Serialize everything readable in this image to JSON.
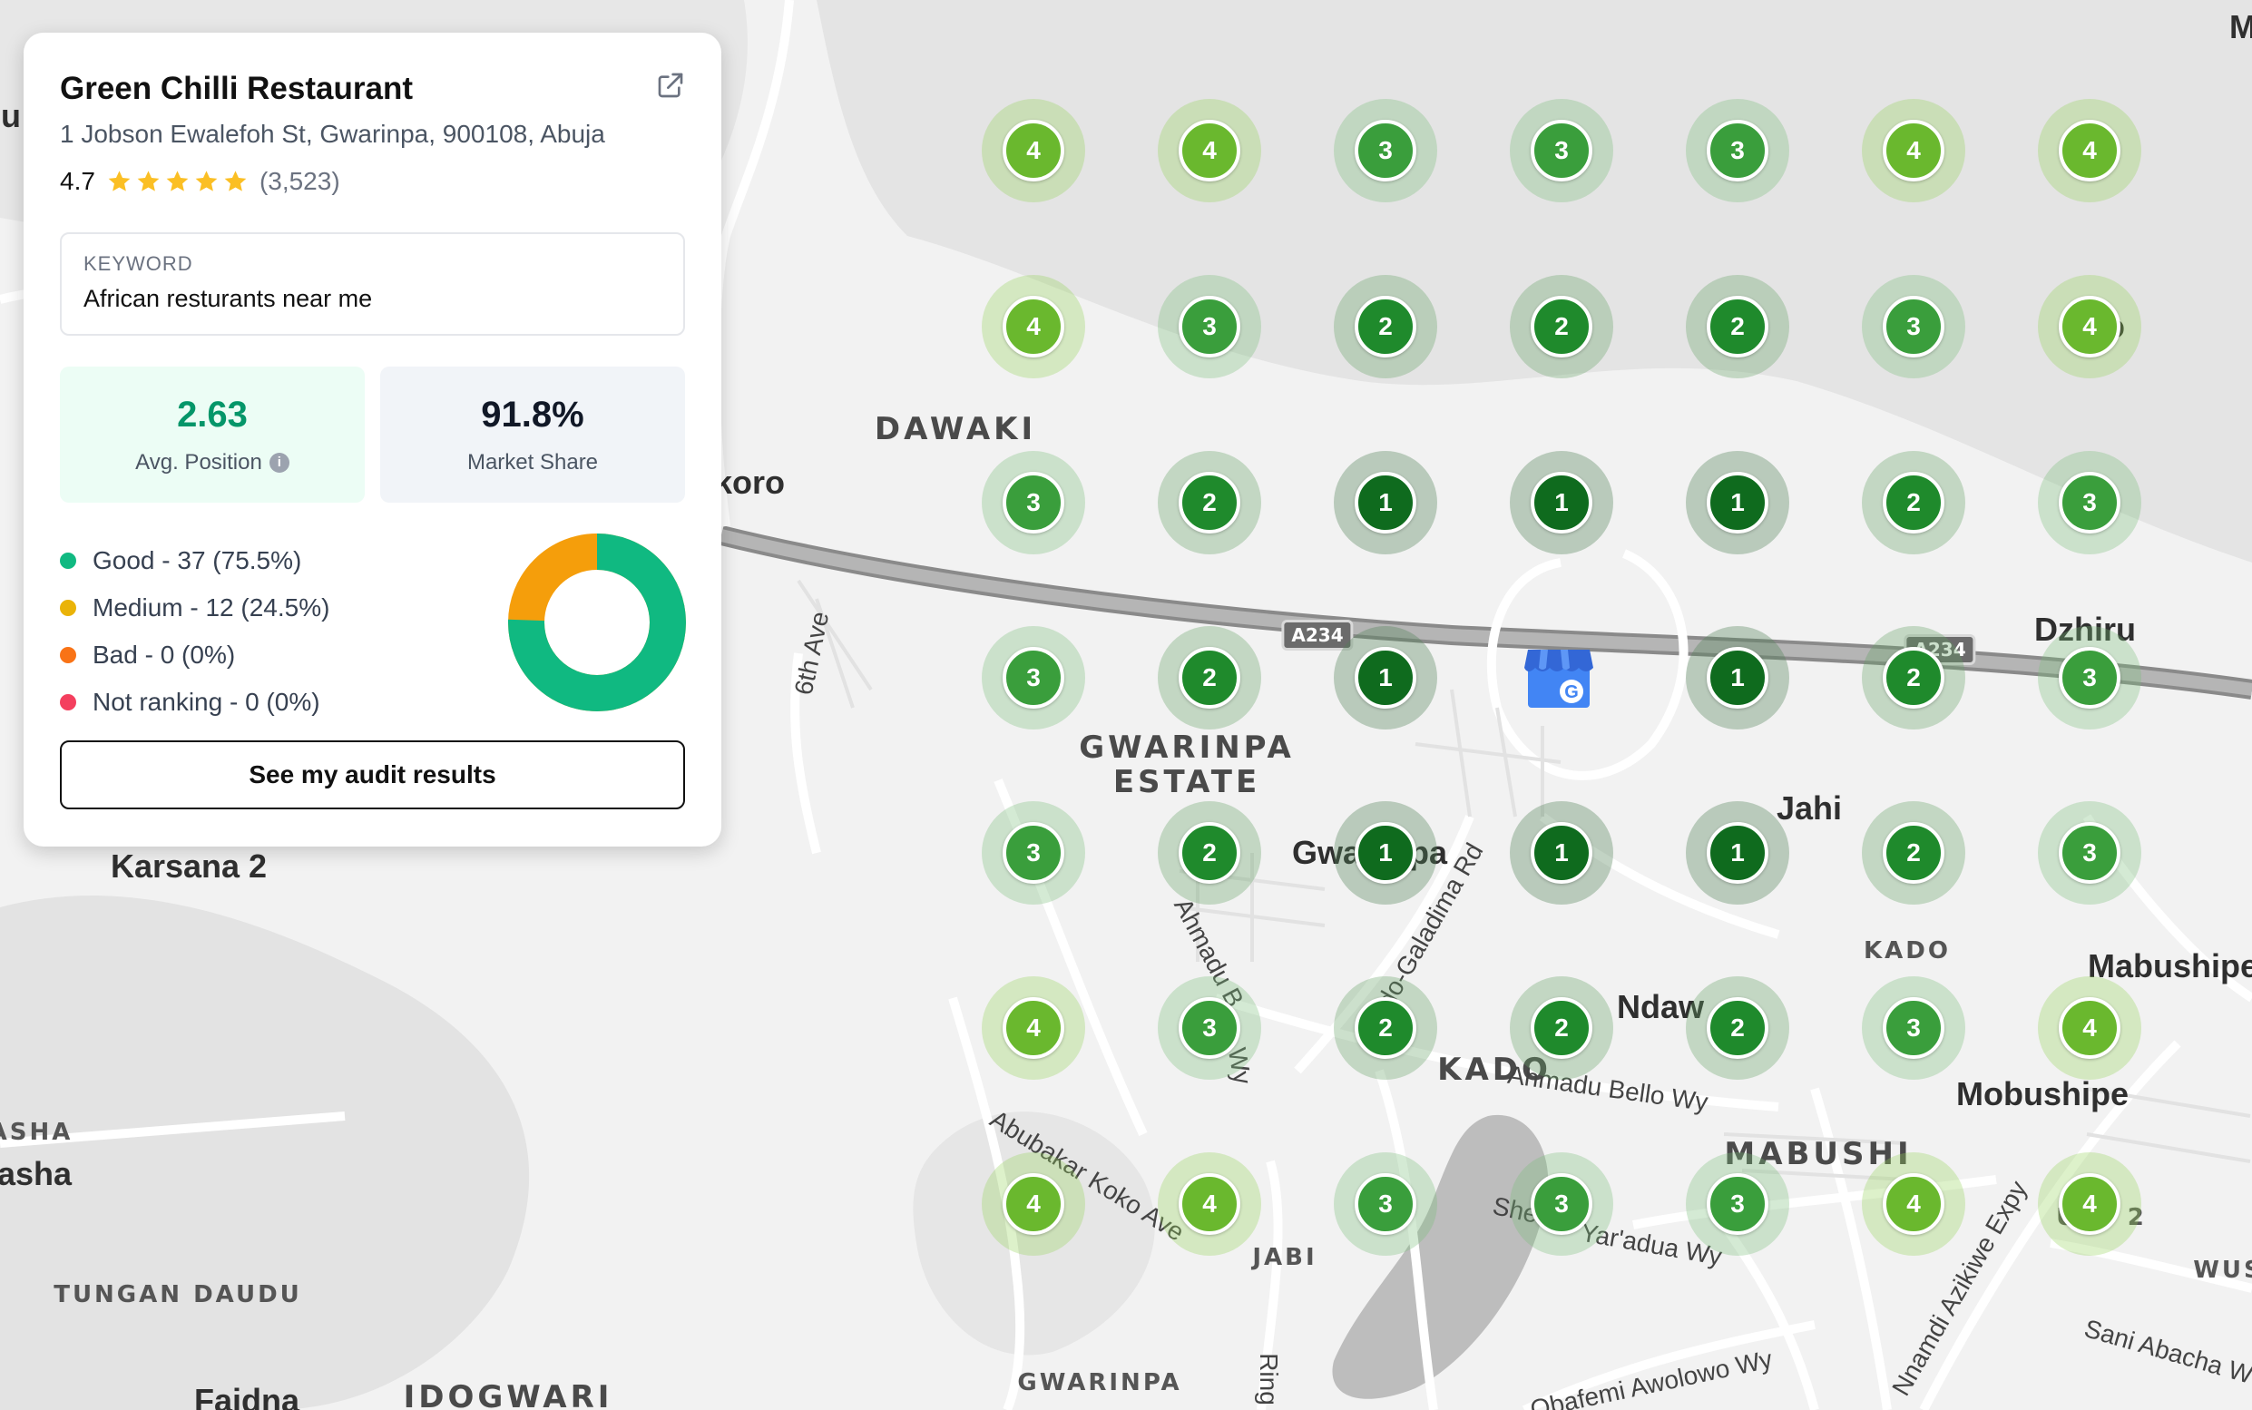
{
  "business": {
    "name": "Green Chilli Restaurant",
    "address": "1 Jobson Ewalefoh St, Gwarinpa, 900108, Abuja",
    "rating": "4.7",
    "stars": 5,
    "review_count": "(3,523)"
  },
  "keyword": {
    "label": "KEYWORD",
    "value": "African resturants near me"
  },
  "stats": {
    "avg_position": "2.63",
    "avg_position_label": "Avg. Position",
    "market_share": "91.8%",
    "market_share_label": "Market Share"
  },
  "legend": [
    {
      "label": "Good - 37 (75.5%)",
      "color": "#10b981"
    },
    {
      "label": "Medium - 12 (24.5%)",
      "color": "#eab308"
    },
    {
      "label": "Bad - 0 (0%)",
      "color": "#f97316"
    },
    {
      "label": "Not ranking - 0 (0%)",
      "color": "#f43f5e"
    }
  ],
  "donut": {
    "good_fraction": 0.755,
    "medium_fraction": 0.245,
    "good_color": "#10b981",
    "medium_color": "#f59e0b"
  },
  "audit_button": "See my audit results",
  "icons": {
    "external_link": "external-link-icon",
    "info": "info-icon",
    "star": "star-icon",
    "business_marker": "google-business-icon"
  },
  "grid": {
    "rows": [
      [
        4,
        4,
        3,
        3,
        3,
        4,
        4
      ],
      [
        4,
        3,
        2,
        2,
        2,
        3,
        4
      ],
      [
        3,
        2,
        1,
        1,
        1,
        2,
        3
      ],
      [
        3,
        2,
        1,
        0,
        1,
        2,
        3
      ],
      [
        3,
        2,
        1,
        1,
        1,
        2,
        3
      ],
      [
        4,
        3,
        2,
        2,
        2,
        3,
        4
      ],
      [
        4,
        4,
        3,
        3,
        3,
        4,
        4
      ]
    ],
    "colors": {
      "1": "#0f6b1e",
      "2": "#1f8a2c",
      "3": "#3a9e3c",
      "4": "#6ab82e"
    },
    "halo_colors": {
      "1": "rgba(80,130,85,0.35)",
      "2": "rgba(100,160,100,0.33)",
      "3": "rgba(120,190,120,0.32)",
      "4": "rgba(150,210,90,0.32)"
    }
  },
  "map_labels": {
    "dawaki": "DAWAKI",
    "koro": "koro",
    "gwarinpa_estate_1": "GWARINPA",
    "gwarinpa_estate_2": "ESTATE",
    "karsana": "Karsana 2",
    "dzhiru": "Dzhiru",
    "jahi": "Jahi",
    "kado_small": "KADO",
    "kado": "KADO",
    "mabushipe": "Mabushipe",
    "mobushipe": "Mobushipe",
    "mabushi": "MABUSHI",
    "jabi": "JABI",
    "tungan_daudu": "TUNGAN DAUDU",
    "idogwari": "IDOGWARI",
    "gwarinpa_bottom": "GWARINPA",
    "faidna": "Faidna",
    "asha_small": "ASHA",
    "asha": "asha",
    "wus": "WUS",
    "use2": "USE 2",
    "oko": "oko",
    "gwa": "Gwa",
    "pa": "pa",
    "ndaw": "Ndaw",
    "sixth_ave": "6th Ave",
    "ahmadu_bello_1": "Ahmadu B",
    "ahmadu_bello_2": "Ahmadu Bello Wy",
    "kado_galadima": "Kado-Galadima Rd",
    "abubakar_koko": "Abubakar Koko Ave",
    "yaradua": "Yar'adua Wy",
    "shehu": "She",
    "nnamdi": "Nnamdi Azikiwe Expy",
    "sani_abacha": "Sani Abacha W",
    "obafemi": "Obafemi Awolowo Wy",
    "ring": "Ring",
    "wy": "Wy",
    "a234_1": "A234",
    "a234_2": "A234",
    "edge_m": "M",
    "edge_u": "u"
  }
}
